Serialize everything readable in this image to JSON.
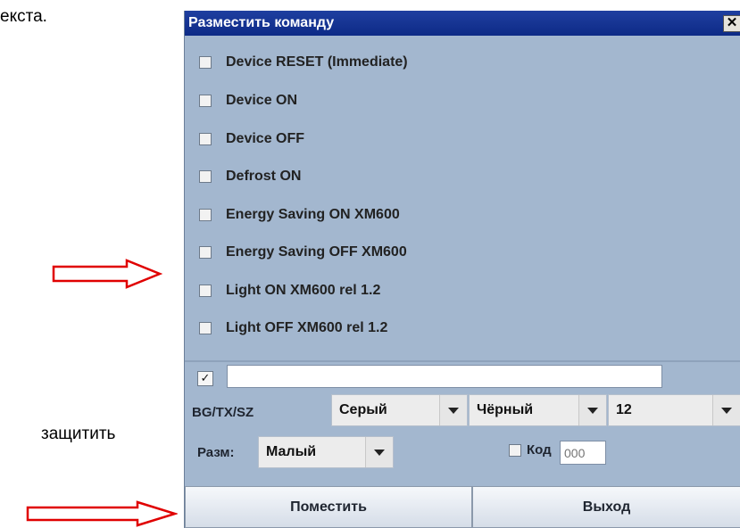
{
  "background": {
    "text_top": "екста.",
    "text_middle": "защитить"
  },
  "dialog": {
    "title": "Разместить команду",
    "close_glyph": "✕",
    "commands": [
      {
        "label": "Device RESET (Immediate)",
        "checked": false
      },
      {
        "label": "Device ON",
        "checked": false
      },
      {
        "label": "Device OFF",
        "checked": false
      },
      {
        "label": "Defrost ON",
        "checked": false
      },
      {
        "label": "Energy Saving ON XM600",
        "checked": false
      },
      {
        "label": "Energy Saving OFF XM600",
        "checked": false
      },
      {
        "label": "Light ON XM600 rel 1.2",
        "checked": false
      },
      {
        "label": "Light OFF XM600 rel 1.2",
        "checked": false
      }
    ],
    "text_checkbox_glyph": "✓",
    "text_value": "",
    "bg_tx_sz_label": "BG/TX/SZ",
    "bg_value": "Серый",
    "tx_value": "Чёрный",
    "sz_value": "12",
    "size_label": "Разм:",
    "size_value": "Малый",
    "code_label": "Код",
    "code_placeholder": "000",
    "place_button": "Поместить",
    "exit_button": "Выход"
  },
  "colors": {
    "dialog_bg": "#a3b7cf",
    "title_bg": "#0d2a86",
    "arrow": "#e00000"
  }
}
